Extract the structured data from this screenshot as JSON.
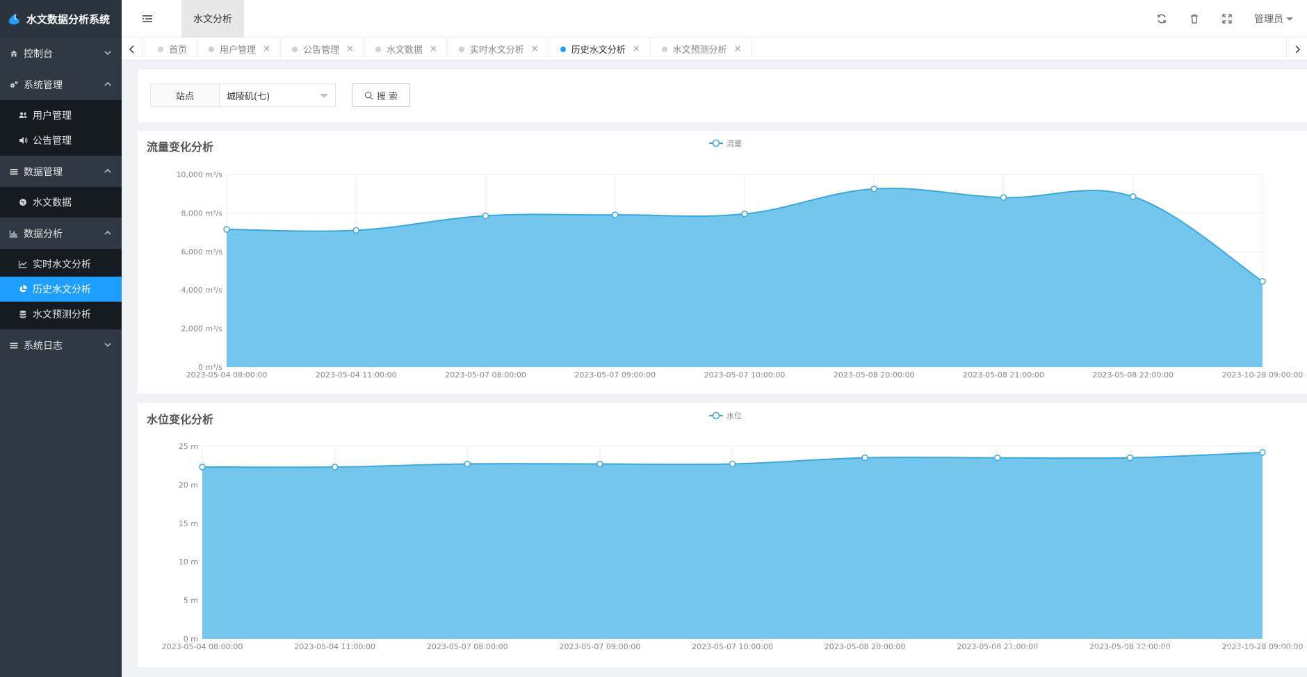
{
  "app": {
    "title": "水文数据分析系统",
    "module_tab": "水文分析",
    "user": "管理员"
  },
  "sidebar": {
    "groups": [
      {
        "label": "控制台",
        "icon": "home-icon",
        "expanded": false,
        "children": []
      },
      {
        "label": "系统管理",
        "icon": "gears-icon",
        "expanded": true,
        "children": [
          {
            "label": "用户管理",
            "icon": "users-icon"
          },
          {
            "label": "公告管理",
            "icon": "volume-icon"
          }
        ]
      },
      {
        "label": "数据管理",
        "icon": "list-icon",
        "expanded": true,
        "children": [
          {
            "label": "水文数据",
            "icon": "globe-icon"
          }
        ]
      },
      {
        "label": "数据分析",
        "icon": "bar-chart-icon",
        "expanded": true,
        "children": [
          {
            "label": "实时水文分析",
            "icon": "line-chart-icon"
          },
          {
            "label": "历史水文分析",
            "icon": "pie-chart-icon",
            "active": true
          },
          {
            "label": "水文预测分析",
            "icon": "database-icon"
          }
        ]
      },
      {
        "label": "系统日志",
        "icon": "list-icon",
        "expanded": false,
        "children": []
      }
    ]
  },
  "tabs": [
    {
      "label": "首页",
      "closable": false
    },
    {
      "label": "用户管理",
      "closable": true
    },
    {
      "label": "公告管理",
      "closable": true
    },
    {
      "label": "水文数据",
      "closable": true
    },
    {
      "label": "实时水文分析",
      "closable": true
    },
    {
      "label": "历史水文分析",
      "closable": true,
      "active": true
    },
    {
      "label": "水文预测分析",
      "closable": true
    }
  ],
  "search": {
    "label": "站点",
    "selected": "城陵矶(七)",
    "button": "搜 索"
  },
  "colors": {
    "accent": "#1e9fff",
    "sidebar_bg": "#2f3843",
    "area_fill": "#6ec3eb",
    "area_line": "#3aa8dd"
  },
  "chart_data": [
    {
      "type": "area",
      "title": "流量变化分析",
      "legend": [
        "流量"
      ],
      "legend_position": "top-center",
      "unit": "m³/s",
      "categories": [
        "2023-05-04 08:00:00",
        "2023-05-04 11:00:00",
        "2023-05-07 08:00:00",
        "2023-05-07 09:00:00",
        "2023-05-07 10:00:00",
        "2023-05-08 20:00:00",
        "2023-05-08 21:00:00",
        "2023-05-08 22:00:00",
        "2023-10-28 09:00:00"
      ],
      "series": [
        {
          "name": "流量",
          "values": [
            7150,
            7100,
            7850,
            7900,
            7950,
            9250,
            8800,
            8850,
            4450
          ]
        }
      ],
      "ylim": [
        0,
        10000
      ],
      "yticks": [
        "0 m³/s",
        "2,000 m³/s",
        "4,000 m³/s",
        "6,000 m³/s",
        "8,000 m³/s",
        "10,000 m³/s"
      ],
      "grid": true
    },
    {
      "type": "area",
      "title": "水位变化分析",
      "legend": [
        "水位"
      ],
      "legend_position": "top-center",
      "unit": "m",
      "categories": [
        "2023-05-04 08:00:00",
        "2023-05-04 11:00:00",
        "2023-05-07 08:00:00",
        "2023-05-07 09:00:00",
        "2023-05-07 10:00:00",
        "2023-05-08 20:00:00",
        "2023-05-08 21:00:00",
        "2023-05-08 22:00:00",
        "2023-10-28 09:00:00"
      ],
      "series": [
        {
          "name": "水位",
          "values": [
            22.3,
            22.3,
            22.7,
            22.7,
            22.7,
            23.5,
            23.5,
            23.5,
            24.2
          ]
        }
      ],
      "ylim": [
        0,
        25
      ],
      "yticks": [
        "0 m",
        "5 m",
        "10 m",
        "15 m",
        "20 m",
        "25 m"
      ],
      "grid": true
    }
  ],
  "watermark": "CSDN @B站计算机毕业设计大学"
}
